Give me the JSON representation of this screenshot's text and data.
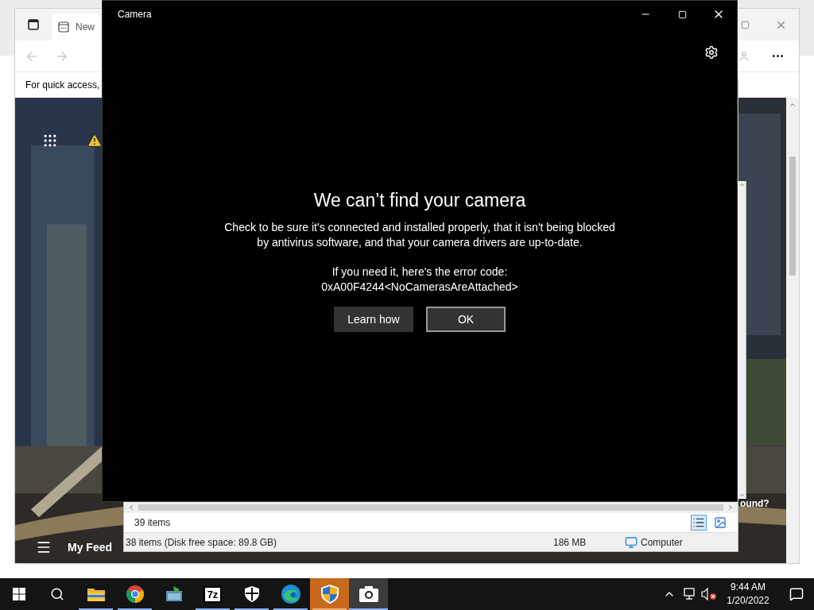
{
  "browser": {
    "tab_label": "New",
    "favorites_hint": "For quick access,",
    "feed_title": "My Feed",
    "partial_text": "ound?"
  },
  "file_explorer": {
    "item_count": "39 items",
    "status_items": "38 items (Disk free space: 89.8 GB)",
    "status_size": "186 MB",
    "status_location": "Computer"
  },
  "camera_window": {
    "title": "Camera",
    "heading": "We can’t find your camera",
    "message": "Check to be sure it's connected and installed properly, that it isn't being blocked by antivirus software, and that your camera drivers are up-to-date.",
    "error_label": "If you need it, here's the error code:",
    "error_code": "0xA00F4244<NoCamerasAreAttached>",
    "buttons": [
      {
        "label": "Learn how",
        "kind": "secondary"
      },
      {
        "label": "OK",
        "kind": "primary"
      }
    ]
  },
  "taskbar": {
    "apps": [
      {
        "kind": "folder",
        "running": true,
        "flashing": false,
        "selected": false
      },
      {
        "kind": "chrome",
        "running": true,
        "flashing": false,
        "selected": false
      },
      {
        "kind": "installer",
        "running": false,
        "flashing": false,
        "selected": false
      },
      {
        "kind": "archiver",
        "label": "7z",
        "running": true,
        "flashing": false,
        "selected": false
      },
      {
        "kind": "security",
        "running": true,
        "flashing": false,
        "selected": false
      },
      {
        "kind": "edge",
        "running": true,
        "flashing": false,
        "selected": false
      },
      {
        "kind": "uac",
        "running": true,
        "flashing": true,
        "selected": false
      },
      {
        "kind": "camera",
        "running": true,
        "flashing": false,
        "selected": true
      }
    ],
    "clock": {
      "time": "9:44 AM",
      "date": "1/20/2022"
    }
  }
}
